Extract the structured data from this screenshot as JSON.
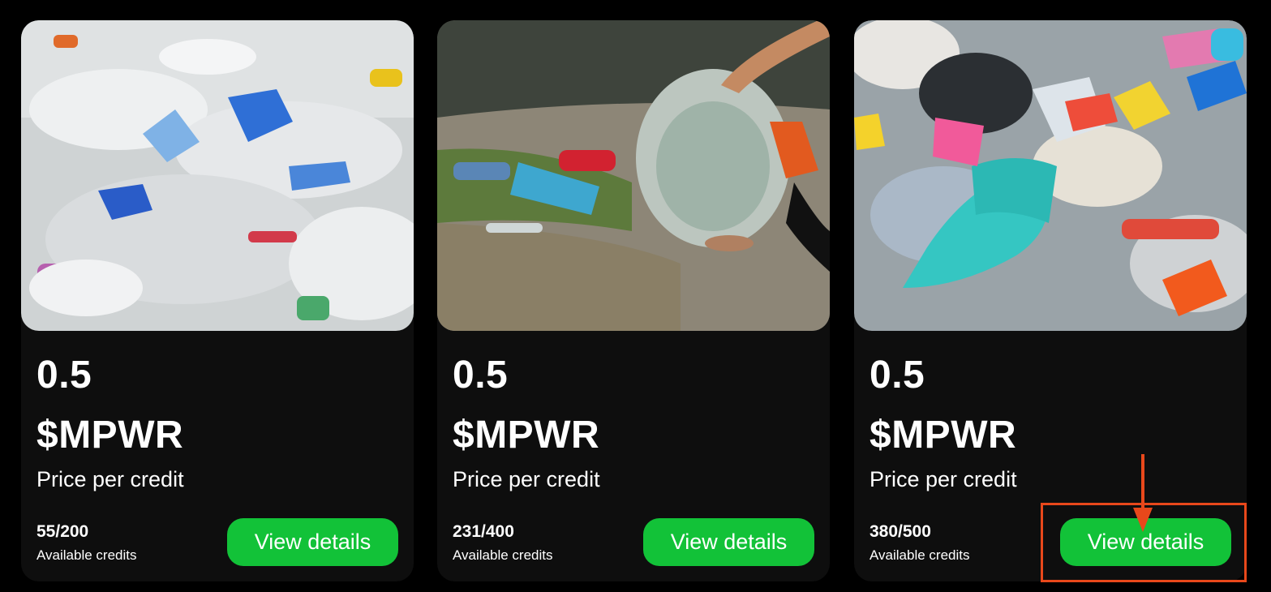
{
  "accent_color": "#12c238",
  "annotation_color": "#e8481b",
  "cards": [
    {
      "image": "plastic-waste-pile-photo",
      "price": "0.5",
      "token": "$MPWR",
      "price_label": "Price per credit",
      "credits": "55/200",
      "credits_label": "Available credits",
      "button_label": "View details"
    },
    {
      "image": "collecting-plastic-bag-photo",
      "price": "0.5",
      "token": "$MPWR",
      "price_label": "Price per credit",
      "credits": "231/400",
      "credits_label": "Available credits",
      "button_label": "View details"
    },
    {
      "image": "colorful-plastic-waste-photo",
      "price": "0.5",
      "token": "$MPWR",
      "price_label": "Price per credit",
      "credits": "380/500",
      "credits_label": "Available credits",
      "button_label": "View details"
    }
  ]
}
